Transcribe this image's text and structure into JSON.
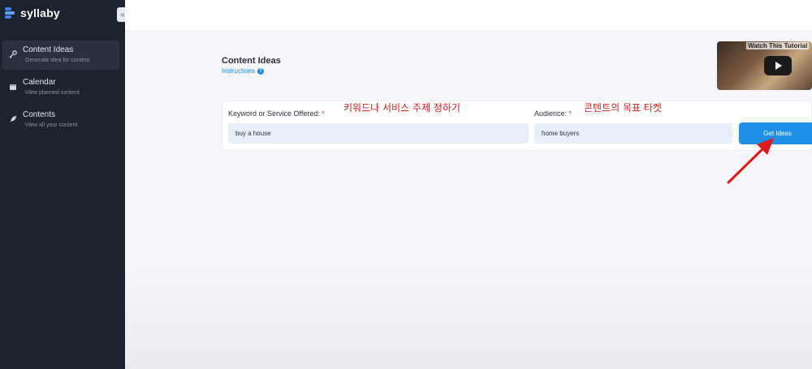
{
  "app": {
    "name": "syllaby"
  },
  "sidebar": {
    "items": [
      {
        "title": "Content Ideas",
        "subtitle": "Generate idea for content",
        "icon": "key-icon",
        "active": true
      },
      {
        "title": "Calendar",
        "subtitle": "View planned content",
        "icon": "calendar-icon",
        "active": false
      },
      {
        "title": "Contents",
        "subtitle": "View all your content",
        "icon": "rocket-icon",
        "active": false
      }
    ]
  },
  "page": {
    "title": "Content Ideas",
    "instructions": "Instructions"
  },
  "video": {
    "title": "Watch This Tutorial"
  },
  "form": {
    "keyword_label": "Keyword or Service Offered:",
    "keyword_value": "buy a house",
    "audience_label": "Audience:",
    "audience_value": "home buyers",
    "required_mark": "*",
    "submit_label": "Get Ideas"
  },
  "annotations": {
    "keyword_note": "키워드나 서비스 주제 정하기",
    "audience_note": "콘텐트의 목표 타켓"
  },
  "colors": {
    "accent": "#1e90e8",
    "sidebar": "#1d2230",
    "annotation": "#e0191b"
  }
}
